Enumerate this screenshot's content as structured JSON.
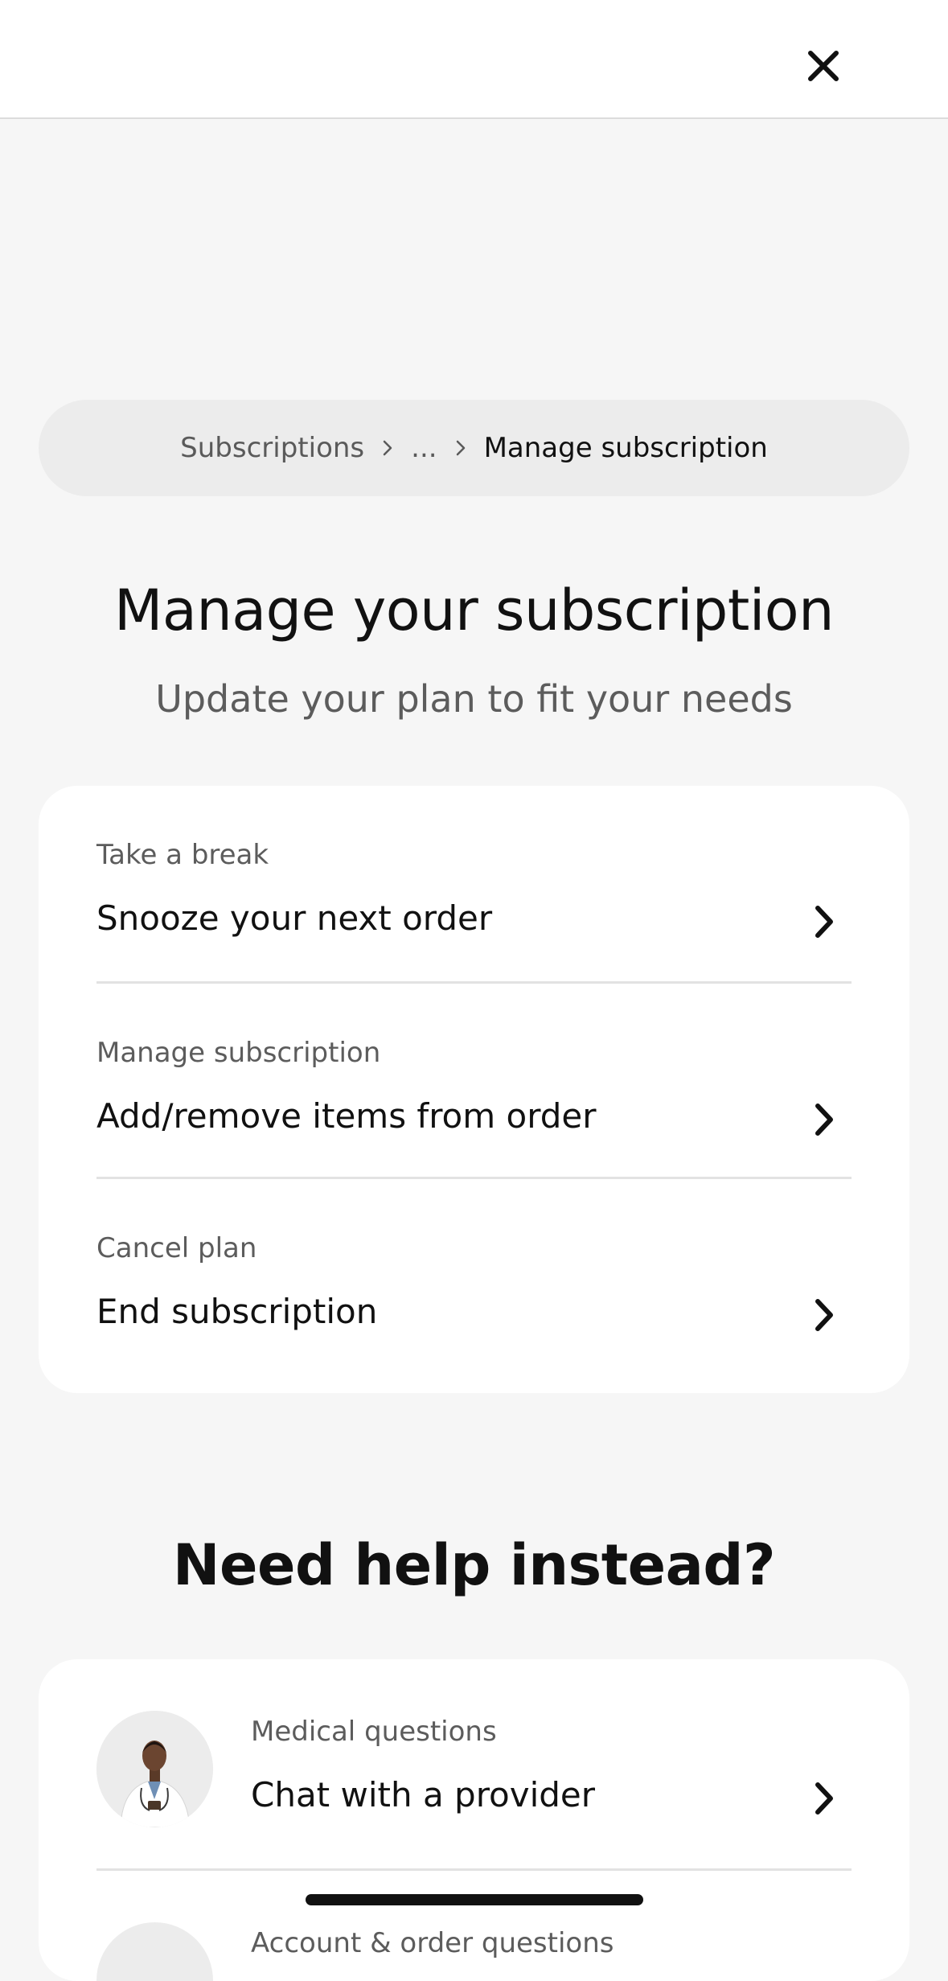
{
  "header": {
    "close_icon": "close-icon"
  },
  "breadcrumb": {
    "items": [
      "Subscriptions",
      "...",
      "Manage subscription"
    ]
  },
  "main": {
    "title": "Manage your subscription",
    "subtitle": "Update your plan to fit your needs",
    "options": [
      {
        "eyebrow": "Take a break",
        "label": "Snooze your next order",
        "icon": "chevron-right-icon"
      },
      {
        "eyebrow": "Manage subscription",
        "label": "Add/remove items from order",
        "icon": "chevron-right-icon"
      },
      {
        "eyebrow": "Cancel plan",
        "label": "End subscription",
        "icon": "chevron-right-icon"
      }
    ]
  },
  "help": {
    "title": "Need help instead?",
    "items": [
      {
        "eyebrow": "Medical questions",
        "label": "Chat with a provider",
        "icon": "chevron-right-icon"
      },
      {
        "eyebrow": "Account & order questions",
        "label": "",
        "icon": "chevron-right-icon"
      }
    ]
  },
  "colors": {
    "background": "#f6f6f6",
    "card": "#ffffff",
    "breadcrumb_bg": "#ececec",
    "text_primary": "#111111",
    "text_secondary": "#5c5c5c"
  }
}
